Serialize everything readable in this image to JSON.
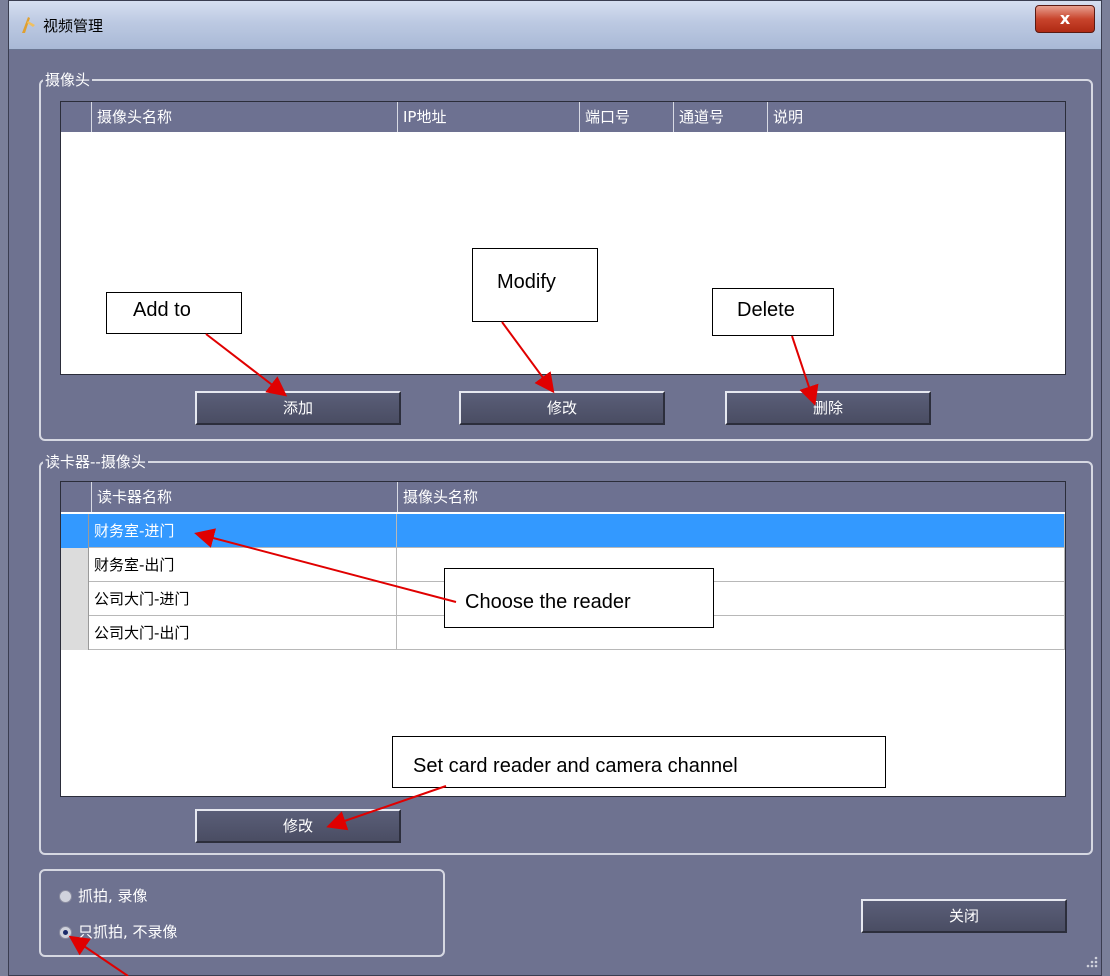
{
  "window": {
    "title": "视频管理",
    "close_label": "x"
  },
  "camera_group": {
    "label": "摄像头",
    "columns": [
      "摄像头名称",
      "IP地址",
      "端口号",
      "通道号",
      "说明"
    ],
    "rows": [],
    "add_label": "添加",
    "modify_label": "修改",
    "delete_label": "删除"
  },
  "reader_group": {
    "label": "读卡器--摄像头",
    "columns": [
      "读卡器名称",
      "摄像头名称"
    ],
    "rows": [
      {
        "reader": "财务室-进门",
        "camera": "",
        "selected": true
      },
      {
        "reader": "财务室-出门",
        "camera": "",
        "selected": false
      },
      {
        "reader": "公司大门-进门",
        "camera": "",
        "selected": false
      },
      {
        "reader": "公司大门-出门",
        "camera": "",
        "selected": false
      }
    ],
    "modify_label": "修改"
  },
  "mode_group": {
    "options": [
      {
        "label": "抓拍, 录像",
        "checked": false
      },
      {
        "label": "只抓拍,  不录像",
        "checked": true
      }
    ]
  },
  "close_button_label": "关闭",
  "annotations": {
    "add_to": "Add to",
    "modify": "Modify",
    "delete": "Delete",
    "choose_reader": "Choose the reader",
    "set_channel": "Set card reader and camera channel"
  },
  "colors": {
    "window_bg": "#6e7290",
    "header_bg": "#6d7191",
    "selection": "#3399ff",
    "arrow": "#e00000"
  }
}
